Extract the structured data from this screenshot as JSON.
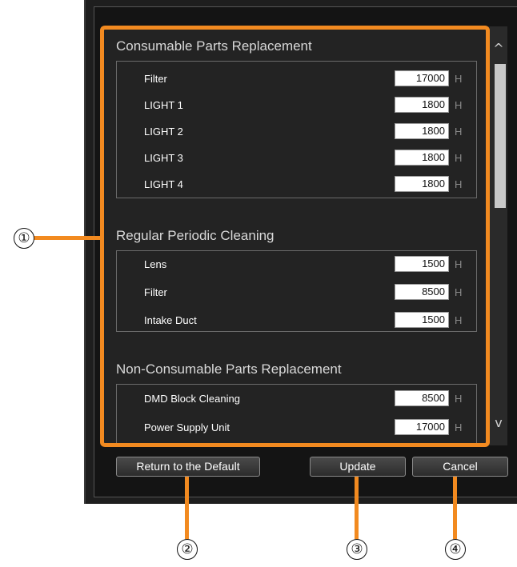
{
  "sections": [
    {
      "title": "Consumable Parts Replacement",
      "rows": [
        {
          "label": "Filter",
          "value": "17000",
          "unit": "H"
        },
        {
          "label": "LIGHT 1",
          "value": "1800",
          "unit": "H"
        },
        {
          "label": "LIGHT 2",
          "value": "1800",
          "unit": "H"
        },
        {
          "label": "LIGHT 3",
          "value": "1800",
          "unit": "H"
        },
        {
          "label": "LIGHT 4",
          "value": "1800",
          "unit": "H"
        }
      ]
    },
    {
      "title": "Regular Periodic Cleaning",
      "rows": [
        {
          "label": "Lens",
          "value": "1500",
          "unit": "H"
        },
        {
          "label": "Filter",
          "value": "8500",
          "unit": "H"
        },
        {
          "label": "Intake Duct",
          "value": "1500",
          "unit": "H"
        }
      ]
    },
    {
      "title": "Non-Consumable Parts Replacement",
      "rows": [
        {
          "label": "DMD Block Cleaning",
          "value": "8500",
          "unit": "H"
        },
        {
          "label": "Power Supply Unit",
          "value": "17000",
          "unit": "H"
        }
      ]
    }
  ],
  "buttons": {
    "default_label": "Return to the Default",
    "update_label": "Update",
    "cancel_label": "Cancel"
  },
  "scrollbar": {
    "up_glyph": "^",
    "down_glyph": "v"
  },
  "callouts": {
    "m1": "①",
    "m2": "②",
    "m3": "③",
    "m4": "④"
  },
  "colors": {
    "callout": "#f28a20",
    "dialog_bg": "#1e1e1e"
  }
}
